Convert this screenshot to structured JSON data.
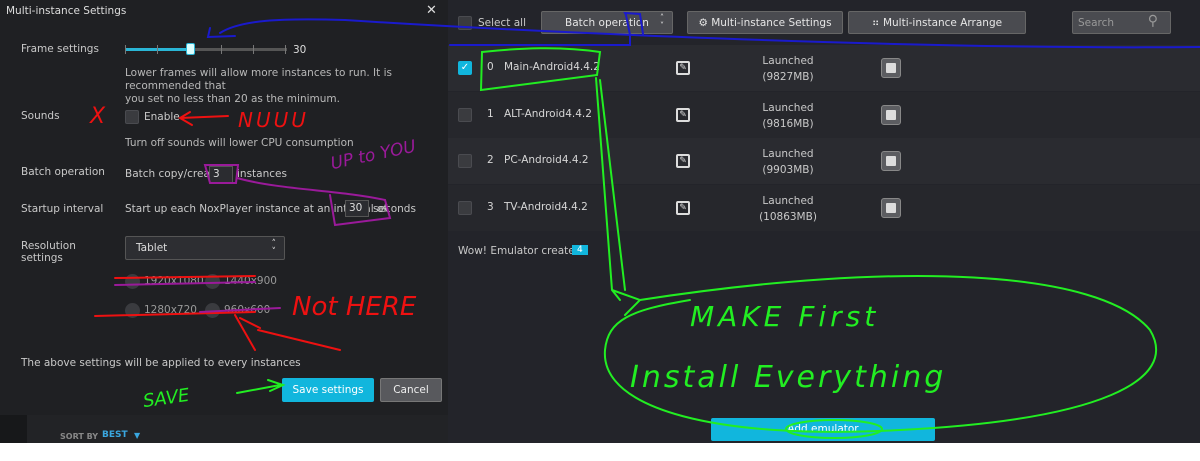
{
  "dialog": {
    "title": "Multi-instance Settings",
    "close": "✕",
    "frame": {
      "label": "Frame settings",
      "value": "30",
      "fraction": 0.4,
      "note1": "Lower frames will allow more instances to run. It is recommended that",
      "note2": "you set no less than 20 as the minimum."
    },
    "sounds": {
      "label": "Sounds",
      "checkbox": "Enable",
      "checked": false,
      "note": "Turn off sounds will lower CPU consumption"
    },
    "batch": {
      "label": "Batch operation",
      "pre": "Batch copy/create",
      "value": "3",
      "post": "instances"
    },
    "startup": {
      "label": "Startup interval",
      "pre": "Start up each NoxPlayer instance at an interval of",
      "value": "30",
      "post": "seconds"
    },
    "resolution": {
      "label1": "Resolution",
      "label2": "settings",
      "selected": "Tablet",
      "options": [
        "1920x1080",
        "1440x900",
        "1280x720",
        "960x600"
      ]
    },
    "footer_note": "The above settings will be applied to every instances",
    "save": "Save settings",
    "cancel": "Cancel"
  },
  "sort": {
    "label": "SORT BY",
    "value": "BEST"
  },
  "toolbar": {
    "select_all": "Select all",
    "batch": "Batch operation",
    "settings": "⚙ Multi-instance Settings",
    "arrange": "⠶ Multi-instance Arrange",
    "search": "Search"
  },
  "instances": [
    {
      "num": "0",
      "name": "Main-Android4.4.2",
      "status": "Launched",
      "mem": "(9827MB)",
      "checked": true
    },
    {
      "num": "1",
      "name": "ALT-Android4.4.2",
      "status": "Launched",
      "mem": "(9816MB)",
      "checked": false
    },
    {
      "num": "2",
      "name": "PC-Android4.4.2",
      "status": "Launched",
      "mem": "(9903MB)",
      "checked": false
    },
    {
      "num": "3",
      "name": "TV-Android4.4.2",
      "status": "Launched",
      "mem": "(10863MB)",
      "checked": false
    }
  ],
  "created": {
    "label": "Wow! Emulator created:",
    "count": "4"
  },
  "add_button": "Add emulator",
  "annotations": {
    "nuuu": "NUUU",
    "x": "X",
    "up_to_you": "UP to YOU",
    "not_here": "Not HERE",
    "save": "SAVE",
    "make_first": "MAKE First",
    "install": "Install Everything"
  },
  "colors": {
    "accent": "#11b6dd",
    "annot_green": "#22ee22",
    "annot_red": "#ee1111",
    "annot_purple": "#9a1a9a",
    "annot_blue": "#1a1acc"
  }
}
